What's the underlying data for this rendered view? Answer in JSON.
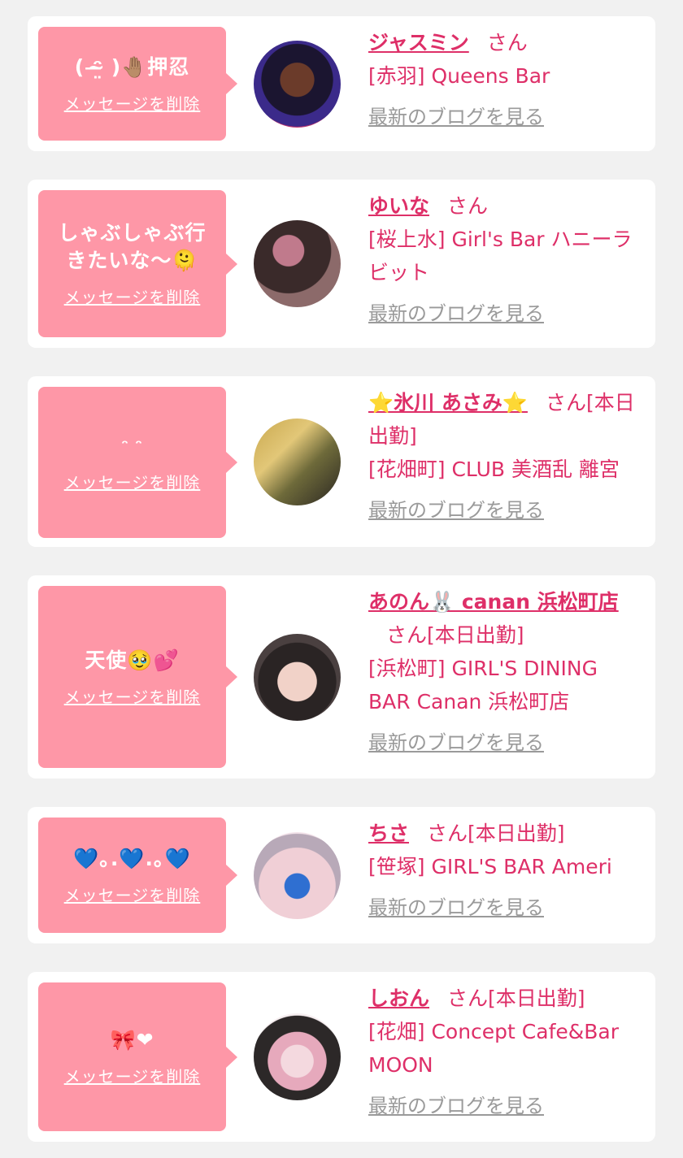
{
  "delete_label": "メッセージを削除",
  "blog_label": "最新のブログを見る",
  "colors": {
    "page_bg": "#f1f1f1",
    "bubble": "#fe97a7",
    "accent": "#de2f68",
    "muted": "#9a9a9a"
  },
  "items": [
    {
      "message": "( ᵔ̴̶̤ )🤚🏽押忍",
      "name": "ジャスミン",
      "san": "さん",
      "shop": "[赤羽] Queens Bar"
    },
    {
      "message": "しゃぶしゃぶ行きたいな〜🫠",
      "name": "ゆいな",
      "san": "さん",
      "shop": "[桜上水] Girl's Bar ハニーラビット"
    },
    {
      "message": "ᵔ ᵔ",
      "name": "⭐氷川 あさみ⭐",
      "san": "さん[本日出勤]",
      "shop": "[花畑町] CLUB 美酒乱 離宮"
    },
    {
      "message": "天使🥹💕",
      "name": "あのん🐰 canan 浜松町店",
      "san": "さん[本日出勤]",
      "shop": "[浜松町] GIRL'S DINING BAR Canan 浜松町店"
    },
    {
      "message": "💙｡.💙.｡💙",
      "name": "ちさ",
      "san": "さん[本日出勤]",
      "shop": "[笹塚] GIRL'S BAR Ameri"
    },
    {
      "message": "🎀❤",
      "name": "しおん",
      "san": "さん[本日出勤]",
      "shop": "[花畑] Concept Cafe&Bar MOON"
    }
  ]
}
